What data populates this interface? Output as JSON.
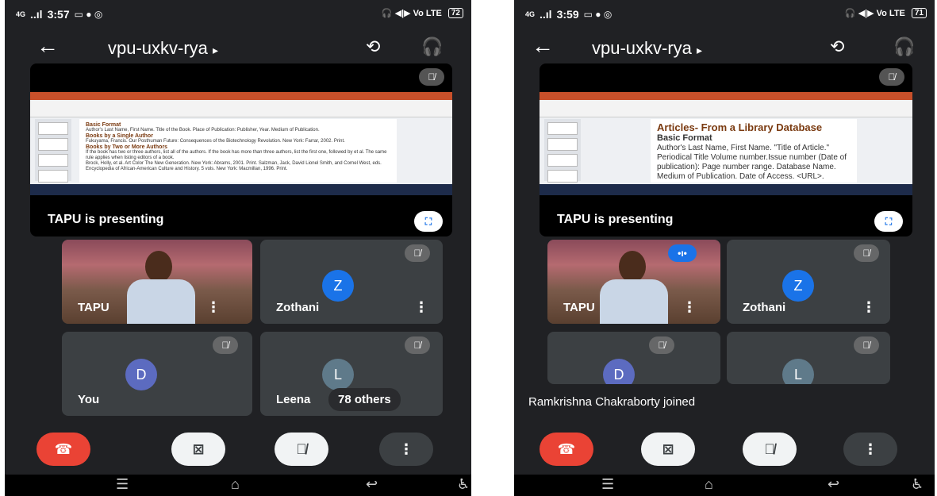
{
  "screens": [
    {
      "status": {
        "network": "4G",
        "signal": "..ıl",
        "time": "3:57",
        "icons": "▭ ● ◎",
        "right_icons": "🎧 ◀|▶ Vo LTE",
        "battery": "72"
      },
      "meeting_code": "vpu-uxkv-rya",
      "presenting_label": "TAPU is presenting",
      "slide": {
        "heading1": "Basic Format",
        "text1": "Author's Last Name, First Name. Title of the Book. Place of Publication: Publisher, Year. Medium of Publication.",
        "heading2": "Books by a Single Author",
        "text2": "Fukuyama, Francis. Our Posthuman Future: Consequences of the Biotechnology Revolution. New York: Farrar, 2002. Print.",
        "heading3": "Books by Two or More Authors",
        "text3": "If the book has two or three authors, list all of the authors. If the book has more than three authors, list the first one, followed by et al. The same rule applies when listing editors of a book.",
        "text4": "Brock, Holly, et al. Art Color The New Generation. New York: Abrams, 2001. Print. Salzman, Jack, David Lionel Smith, and Cornel West, eds. Encyclopedia of African-American Culture and History. 5 vols. New York: Macmillan, 1996. Print."
      },
      "tiles": [
        {
          "name": "TAPU",
          "type": "video"
        },
        {
          "name": "Zothani",
          "initial": "Z",
          "color": "#1a73e8"
        },
        {
          "name": "You",
          "initial": "D",
          "color": "#5c6bc0"
        },
        {
          "name": "Leena",
          "initial": "L",
          "color": "#5f7a8a"
        }
      ],
      "others_label": "78 others"
    },
    {
      "status": {
        "network": "4G",
        "signal": "..ıl",
        "time": "3:59",
        "icons": "▭ ● ◎",
        "right_icons": "🎧 ◀|▶ Vo LTE",
        "battery": "71"
      },
      "meeting_code": "vpu-uxkv-rya",
      "presenting_label": "TAPU is presenting",
      "slide": {
        "heading": "Articles- From a Library Database",
        "bullet1": "Basic Format",
        "bullet2": "Author's Last Name, First Name. \"Title of Article.\" Periodical Title Volume number.Issue number (Date of publication): Page number range. Database Name. Medium of Publication. Date of Access. <URL>."
      },
      "tiles": [
        {
          "name": "TAPU",
          "type": "video"
        },
        {
          "name": "Zothani",
          "initial": "Z",
          "color": "#1a73e8"
        },
        {
          "name": "",
          "initial": "D",
          "color": "#5c6bc0"
        },
        {
          "name": "",
          "initial": "L",
          "color": "#5f7a8a"
        }
      ],
      "toast": "Ramkrishna Chakraborty joined"
    }
  ],
  "icons": {
    "back": "←",
    "code_arrow": "▸",
    "flip_camera": "⟲",
    "audio": "🎧",
    "fullscreen": "⛶",
    "mute": "🎙̸",
    "more": "⋮",
    "end_call": "☎",
    "camera_off": "⊠",
    "speaking": "•ı•",
    "nav_menu": "☰",
    "nav_home": "⌂",
    "nav_back": "↩",
    "nav_accessibility": "♿"
  }
}
